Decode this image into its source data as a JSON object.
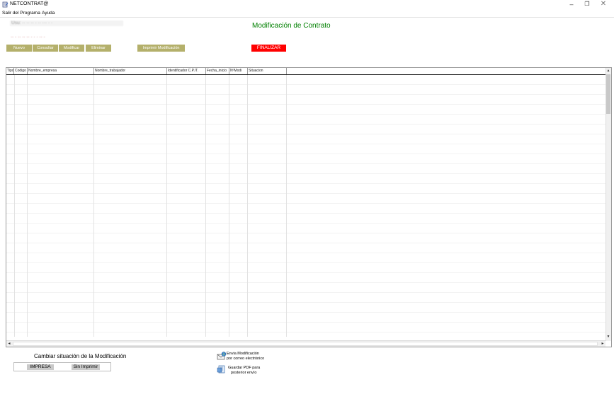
{
  "window": {
    "title": "NETCONTRAT@",
    "controls": {
      "minimize": "–",
      "maximize": "❐",
      "close": "✕"
    }
  },
  "menu": {
    "items": [
      "Salir del Programa",
      "Ayuda"
    ]
  },
  "info": {
    "line1": "Usu: ·· ·· ·· · ·· ··· · ·",
    "line2": "·· · ·· ·· ·· · · · ·· ·"
  },
  "page_title": "Modificación de Contrato",
  "toolbar": {
    "nuevo": "Nuevo",
    "consultar": "Consultar",
    "modificar": "Modificar",
    "eliminar": "Eliminar",
    "imprimir": "Imprimir Modificación",
    "finalizar": "FINALIZAR"
  },
  "grid": {
    "columns": [
      "Tipo",
      "Codigo",
      "Nombre_empresa",
      "Nombre_trabajador",
      "Identificador C.P./T.",
      "Fecha_inicio",
      "NºModi",
      "Situacion"
    ],
    "rows": []
  },
  "status_section": {
    "label": "Cambiar situación de la Modificación",
    "impresa": "IMPRESA",
    "sin_imprimir": "Sin Imprimir"
  },
  "actions": {
    "email_line1": "Envia Modificación",
    "email_line2": "por correo electrónico",
    "pdf_line1": "Guardar PDF para",
    "pdf_line2": "posterior envío"
  },
  "colors": {
    "accent_green": "#008000",
    "button_olive": "#b4b06b",
    "finalizar_red": "#ff0000"
  },
  "icons": [
    "app-icon",
    "email-icon",
    "pdf-icon"
  ]
}
